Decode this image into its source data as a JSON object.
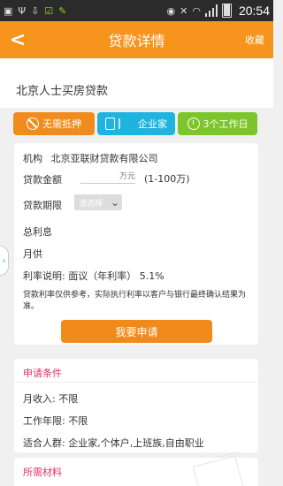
{
  "status_bar": {
    "time": "20:54"
  },
  "header": {
    "title": "贷款详情",
    "favorite_label": "收藏"
  },
  "product": {
    "name": "北京人士买房贷款"
  },
  "tags": [
    {
      "label": "无需抵押",
      "icon": "no-collateral-icon",
      "color": "#f08c1d"
    },
    {
      "label": "企业家",
      "icon": "document-icon",
      "color": "#1fb4e0"
    },
    {
      "label": "3个工作日",
      "icon": "clock-icon",
      "color": "#7cc52a"
    }
  ],
  "details": {
    "institution_label": "机构",
    "institution_value": "北京亚联财贷款有限公司",
    "amount_label": "贷款金额",
    "amount_placeholder": "万元",
    "amount_range": "(1-100万)",
    "term_label": "贷款期限",
    "term_placeholder": "请选择",
    "total_interest_label": "总利息",
    "monthly_label": "月供",
    "rate_label": "利率说明: 面议（年利率） 5.1%",
    "note": "贷款利率仅供参考，实际执行利率以客户与银行最终确认结果为准。",
    "apply_button": "我要申请"
  },
  "conditions": {
    "title": "申请条件",
    "income": "月收入:  不限",
    "work_years": "工作年限:  不限",
    "audience": "适合人群:  企业家,个体户,上班族,自由职业"
  },
  "materials": {
    "title": "所需材料"
  },
  "colors": {
    "accent": "#f7941d",
    "section_title": "#e1306c"
  }
}
